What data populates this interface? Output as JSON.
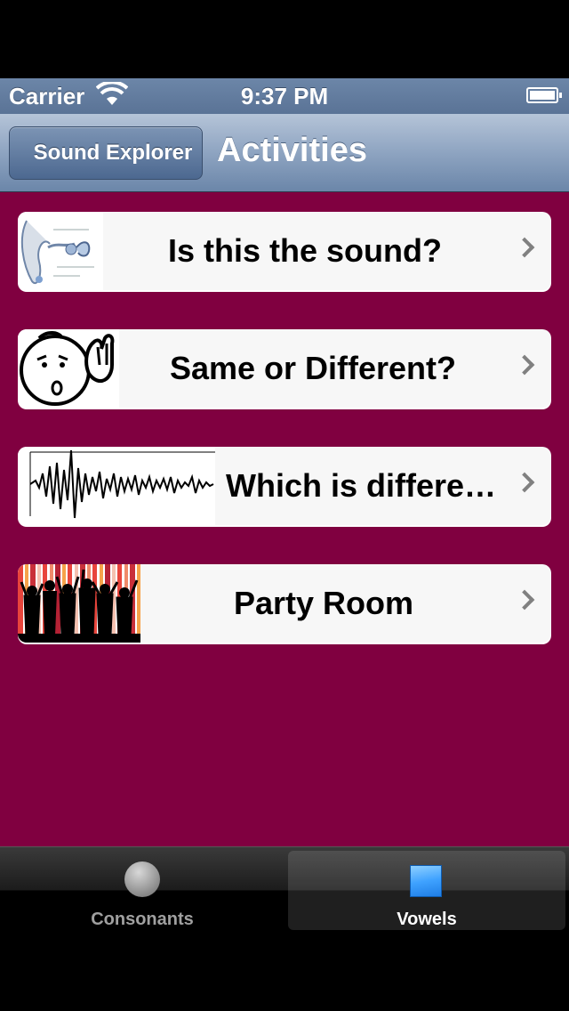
{
  "status_bar": {
    "carrier": "Carrier",
    "time": "9:37 PM",
    "wifi_icon": "wifi-icon",
    "battery_icon": "battery-icon"
  },
  "nav_bar": {
    "back_label": "Sound Explorer",
    "title": "Activities"
  },
  "rows": [
    {
      "label": "Is this the sound?",
      "image": "ear-anatomy-image"
    },
    {
      "label": "Same or Different?",
      "image": "listening-face-image"
    },
    {
      "label": "Which is differe…",
      "image": "waveform-image"
    },
    {
      "label": "Party Room",
      "image": "party-silhouettes-image"
    }
  ],
  "tab_bar": {
    "tabs": [
      {
        "label": "Consonants",
        "icon": "circle-icon",
        "selected": false
      },
      {
        "label": "Vowels",
        "icon": "square-icon",
        "selected": true
      }
    ]
  },
  "colors": {
    "content_background": "#800040",
    "nav_bar": "#6b86a9",
    "row_background": "#f7f7f7"
  }
}
